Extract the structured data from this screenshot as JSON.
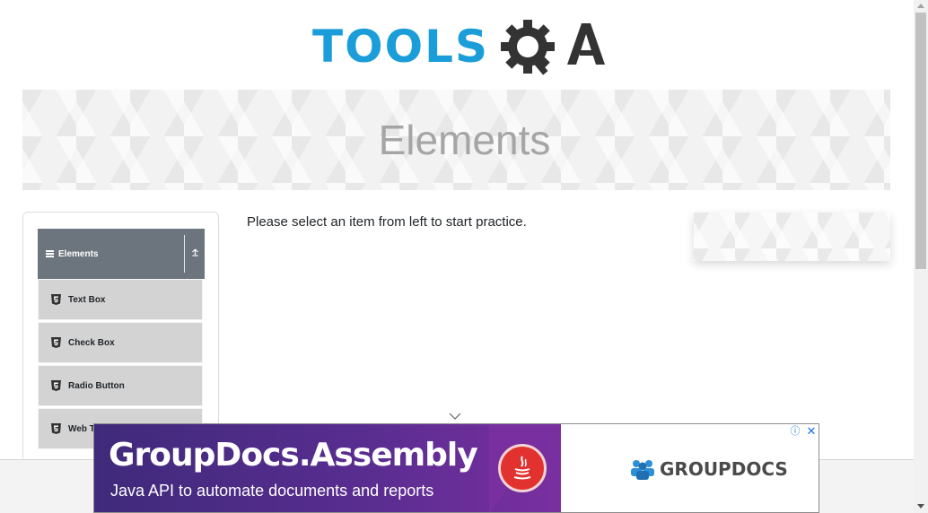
{
  "logo": {
    "tools_text": "TOOLS",
    "qa_text": "QA",
    "brand_color": "#1a9dd8",
    "icon": "gear-magnifier-icon"
  },
  "banner": {
    "title": "Elements"
  },
  "sidebar": {
    "group": {
      "label": "Elements",
      "icon": "hamburger-icon",
      "toggle_icon": "collapse-arrow-icon"
    },
    "items": [
      {
        "label": "Text Box",
        "icon": "html5-icon"
      },
      {
        "label": "Check Box",
        "icon": "html5-icon"
      },
      {
        "label": "Radio Button",
        "icon": "html5-icon"
      },
      {
        "label": "Web T",
        "icon": "html5-icon"
      }
    ]
  },
  "main": {
    "instruction": "Please select an item from left to start practice."
  },
  "ad": {
    "title": "GroupDocs.Assembly",
    "subtitle": "Java API to automate documents and reports",
    "brand": "GROUPDOCS",
    "info_icon": "info-icon",
    "close_icon": "close-icon",
    "product_icon": "java-icon"
  },
  "colors": {
    "sidebar_header": "#6c757d",
    "menu_item": "#d3d3d3",
    "ad_purple": "#5a2d91",
    "java_red": "#e2322f"
  }
}
